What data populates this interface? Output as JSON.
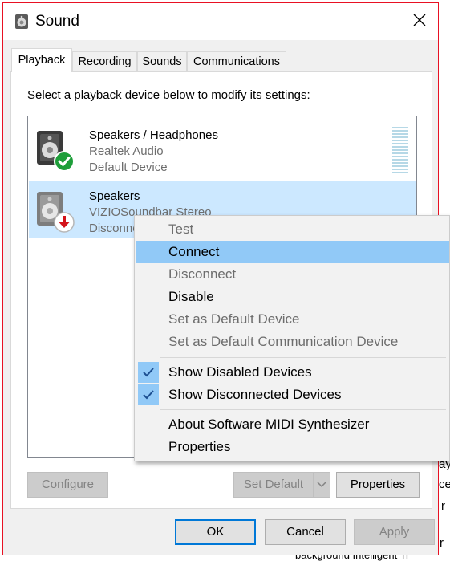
{
  "window": {
    "title": "Sound"
  },
  "tabs": [
    {
      "label": "Playback",
      "active": true
    },
    {
      "label": "Recording",
      "active": false
    },
    {
      "label": "Sounds",
      "active": false
    },
    {
      "label": "Communications",
      "active": false
    }
  ],
  "playback": {
    "instruction": "Select a playback device below to modify its settings:",
    "devices": [
      {
        "name": "Speakers / Headphones",
        "driver": "Realtek Audio",
        "status": "Default Device",
        "status_icon": "green-check-icon"
      },
      {
        "name": "Speakers",
        "driver": "VIZIOSoundbar Stereo",
        "status": "Disconne",
        "status_icon": "red-down-arrow-icon",
        "selected": true
      }
    ]
  },
  "context_menu": {
    "items": [
      {
        "label": "Test",
        "enabled": false
      },
      {
        "label": "Connect",
        "enabled": true,
        "highlighted": true
      },
      {
        "label": "Disconnect",
        "enabled": false
      },
      {
        "label": "Disable",
        "enabled": true
      },
      {
        "label": "Set as Default Device",
        "enabled": false
      },
      {
        "label": "Set as Default Communication Device",
        "enabled": false
      },
      {
        "label": "Show Disabled Devices",
        "enabled": true,
        "checked": true
      },
      {
        "label": "Show Disconnected Devices",
        "enabled": true,
        "checked": true
      },
      {
        "label": "About Software MIDI Synthesizer",
        "enabled": true
      },
      {
        "label": "Properties",
        "enabled": true
      }
    ]
  },
  "panel_buttons": {
    "configure": "Configure",
    "set_default": "Set Default",
    "properties": "Properties"
  },
  "dialog_buttons": {
    "ok": "OK",
    "cancel": "Cancel",
    "apply": "Apply"
  },
  "background_fragments": [
    "ay",
    "ce",
    "r",
    "r",
    "r",
    "r",
    "background Intelligent Tr"
  ],
  "colors": {
    "selection": "#cce8ff",
    "menu_highlight": "#91c9f7",
    "focus_border": "#0078d7",
    "window_border": "#e81123"
  }
}
